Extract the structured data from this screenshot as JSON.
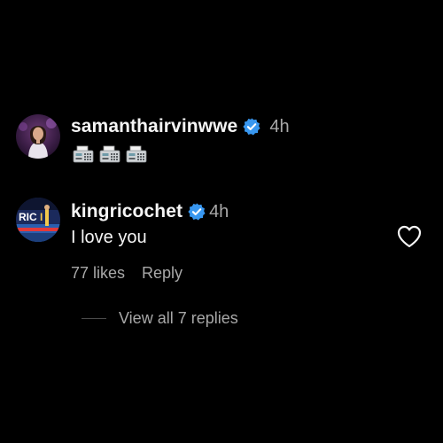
{
  "comments": [
    {
      "username": "samanthairvinwwe",
      "time": "4h",
      "verified": true,
      "emoji": [
        "fax-machine",
        "fax-machine",
        "fax-machine"
      ]
    },
    {
      "username": "kingricochet",
      "time": "4h",
      "verified": true,
      "text": "I love you",
      "likes": "77 likes",
      "reply_label": "Reply"
    }
  ],
  "view_replies": "View all 7 replies",
  "colors": {
    "background": "#000000",
    "primary_text": "#f5f5f5",
    "secondary_text": "#a8a8a8",
    "verified": "#3897f0"
  }
}
